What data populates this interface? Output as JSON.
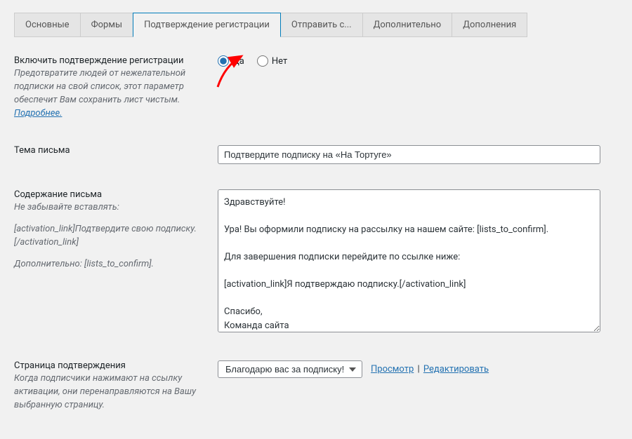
{
  "tabs": {
    "basic": "Основные",
    "forms": "Формы",
    "confirm": "Подтверждение регистрации",
    "send": "Отправить с...",
    "advanced": "Дополнительно",
    "addons": "Дополнения"
  },
  "enable": {
    "title": "Включить подтверждение регистрации",
    "desc": "Предотвратите людей от нежелательной подписки на свой список, этот параметр обеспечит Вам сохранить лист чистым. ",
    "more": "Подробнее.",
    "yes": "Да",
    "no": "Нет"
  },
  "subject": {
    "title": "Тема письма",
    "value": "Подтвердите подписку на «На Тортуге»"
  },
  "content": {
    "title": "Содержание письма",
    "hint": "Не забывайте вставлять:",
    "code1": "[activation_link]Подтвердите свою подписку.[/activation_link]",
    "code2": "Дополнительно: [lists_to_confirm].",
    "value": "Здравствуйте!\n\nУра! Вы оформили подписку на рассылку на нашем сайте: [lists_to_confirm].\n\nДля завершения подписки перейдите по ссылке ниже:\n\n[activation_link]Я подтверждаю подписку.[/activation_link]\n\nСпасибо,\nКоманда сайта"
  },
  "page": {
    "title": "Страница подтверждения",
    "desc": "Когда подписчики нажимают на ссылку активации, они перенаправляются на Вашу выбранную страницу.",
    "selected": "Благодарю вас за подписку!",
    "preview": "Просмотр",
    "edit": "Редактировать",
    "sep": "|"
  }
}
